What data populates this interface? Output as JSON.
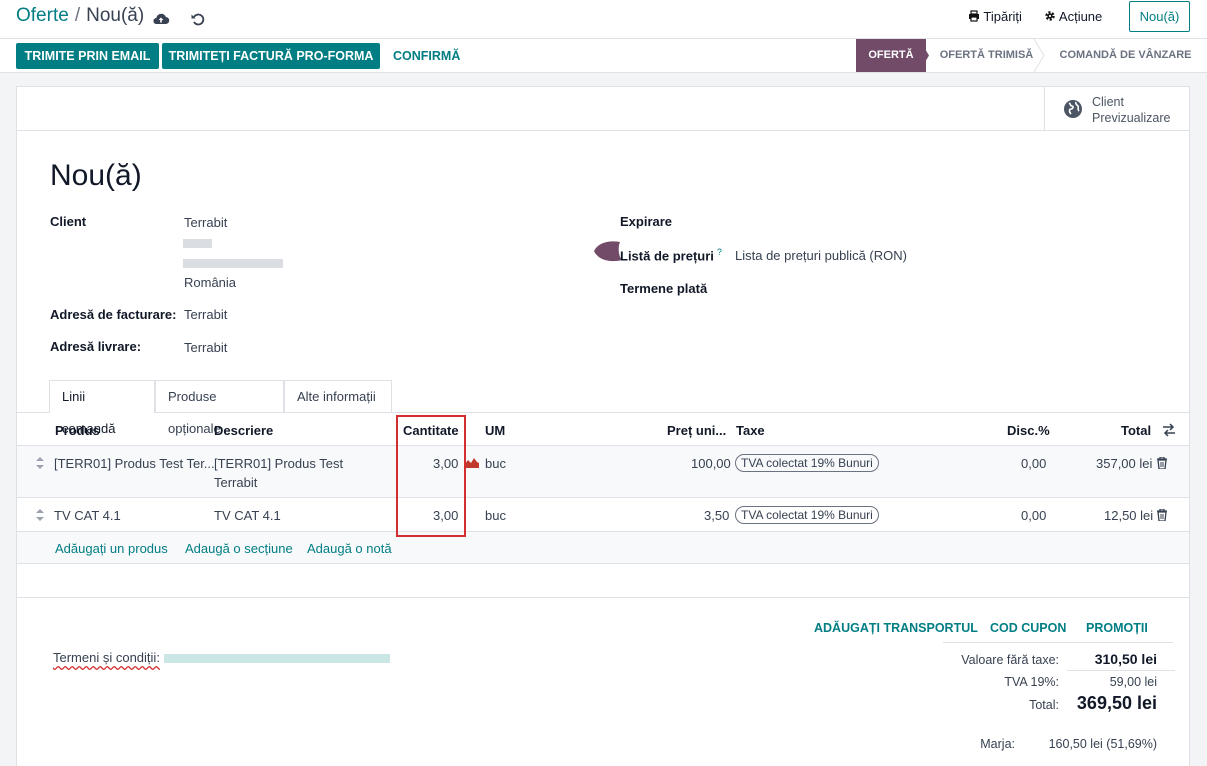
{
  "breadcrumb": {
    "parent": "Oferte",
    "separator": "/",
    "current": "Nou(ă)"
  },
  "topbar": {
    "print_label": "Tipăriți",
    "action_label": "Acțiune",
    "pager_label": "Nou(ă)"
  },
  "buttons": {
    "send_email": "TRIMITE PRIN EMAIL",
    "send_proforma": "TRIMITEȚI FACTURĂ PRO-FORMA",
    "confirm": "CONFIRMĂ"
  },
  "stages": [
    {
      "label": "OFERTĂ",
      "active": true
    },
    {
      "label": "OFERTĂ TRIMISĂ",
      "active": false
    },
    {
      "label": "COMANDĂ DE VÂNZARE",
      "active": false
    }
  ],
  "smart_button": {
    "line1": "Client",
    "line2": "Previzualizare"
  },
  "record": {
    "title": "Nou(ă)",
    "client_label": "Client",
    "client_name": "Terrabit",
    "client_country": "România",
    "invoice_address_label": "Adresă de facturare:",
    "invoice_address": "Terrabit",
    "delivery_address_label": "Adresă livrare:",
    "delivery_address": "Terrabit",
    "expiry_label": "Expirare",
    "pricelist_label": "Listă de prețuri",
    "pricelist_help": "?",
    "pricelist_value": "Lista de prețuri publică (RON)",
    "payment_terms_label": "Termene plată"
  },
  "tabs": [
    "Linii comandă",
    "Produse opționale",
    "Alte informații"
  ],
  "table": {
    "headers": {
      "product": "Produs",
      "description": "Descriere",
      "quantity": "Cantitate",
      "uom": "UM",
      "price": "Preț uni...",
      "taxes": "Taxe",
      "discount": "Disc.%",
      "total": "Total"
    },
    "rows": [
      {
        "product": "[TERR01] Produs Test Ter...",
        "desc1": "[TERR01] Produs Test",
        "desc2": "Terrabit",
        "qty": "3,00",
        "uom": "buc",
        "price": "100,00",
        "tax": "TVA colectat 19% Bunuri",
        "disc": "0,00",
        "total": "357,00 lei"
      },
      {
        "product": "TV CAT 4.1",
        "desc1": "TV CAT 4.1",
        "desc2": "",
        "qty": "3,00",
        "uom": "buc",
        "price": "3,50",
        "tax": "TVA colectat 19% Bunuri",
        "disc": "0,00",
        "total": "12,50 lei"
      }
    ],
    "add_product": "Adăugați un produs",
    "add_section": "Adaugă o secțiune",
    "add_note": "Adaugă o notă"
  },
  "footer": {
    "add_shipping": "ADĂUGAȚI TRANSPORTUL",
    "coupon": "COD CUPON",
    "promotions": "PROMOȚII",
    "terms_label": "Termeni și condiții:",
    "untaxed_label": "Valoare fără taxe:",
    "untaxed_value": "310,50 lei",
    "vat_label": "TVA 19%:",
    "vat_value": "59,00 lei",
    "total_label": "Total:",
    "total_value": "369,50 lei",
    "margin_label": "Marja:",
    "margin_value": "160,50 lei (51,69%)"
  },
  "colors": {
    "primary": "#017e84",
    "stage_active": "#714b67",
    "highlight": "#d32f2f"
  }
}
